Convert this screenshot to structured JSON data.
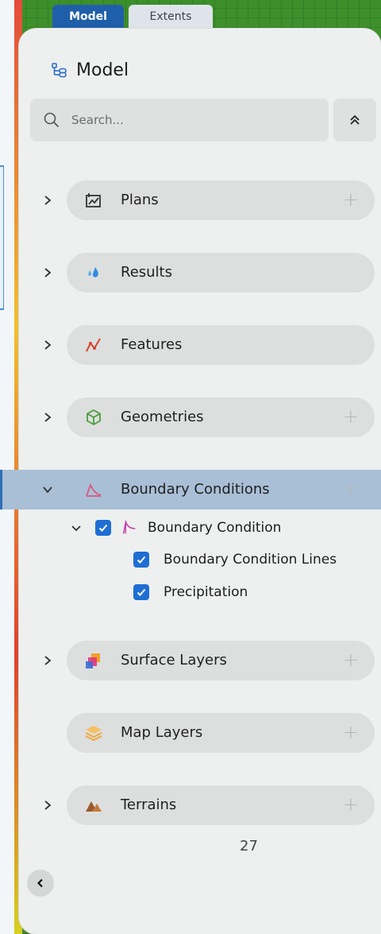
{
  "tabs": [
    {
      "label": "Model",
      "active": true
    },
    {
      "label": "Extents",
      "active": false
    }
  ],
  "panel": {
    "title": "Model",
    "search": {
      "placeholder": "Search..."
    }
  },
  "tree": [
    {
      "label": "Plans",
      "icon": "plans-icon",
      "expandable": true,
      "has_add": true,
      "expanded": false
    },
    {
      "label": "Results",
      "icon": "water-drops-icon",
      "expandable": true,
      "has_add": false,
      "expanded": false
    },
    {
      "label": "Features",
      "icon": "polyline-icon",
      "expandable": true,
      "has_add": false,
      "expanded": false
    },
    {
      "label": "Geometries",
      "icon": "cube-icon",
      "expandable": true,
      "has_add": true,
      "expanded": false
    },
    {
      "label": "Boundary Conditions",
      "icon": "boundary-curve-icon",
      "expandable": true,
      "has_add": true,
      "expanded": true,
      "selected": true,
      "children": [
        {
          "label": "Boundary Condition",
          "checked": true,
          "expanded": true,
          "children": [
            {
              "label": "Boundary Condition Lines",
              "checked": true
            },
            {
              "label": "Precipitation",
              "checked": true
            }
          ]
        }
      ]
    },
    {
      "label": "Surface Layers",
      "icon": "surface-layers-icon",
      "expandable": true,
      "has_add": true,
      "expanded": false
    },
    {
      "label": "Map Layers",
      "icon": "stacked-layers-icon",
      "expandable": false,
      "has_add": true,
      "expanded": false
    },
    {
      "label": "Terrains",
      "icon": "mountains-icon",
      "expandable": true,
      "has_add": true,
      "expanded": false
    }
  ],
  "plus_glyph": "+",
  "page_number": "27",
  "colors": {
    "accent": "#1f6ed4",
    "tab_active": "#1f5faa",
    "selected_row": "#a9bfd6"
  }
}
